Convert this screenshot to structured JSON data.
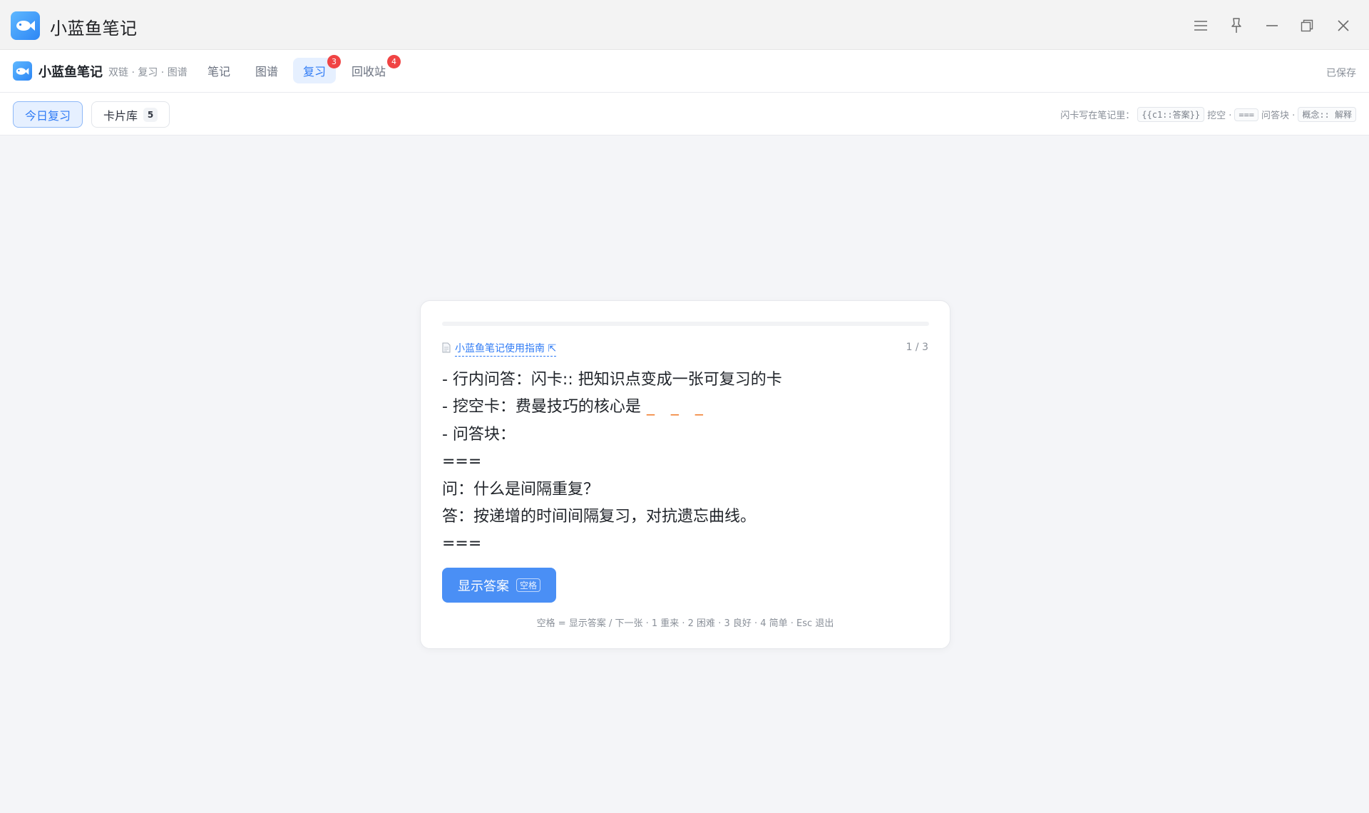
{
  "window": {
    "title": "小蓝鱼笔记"
  },
  "nav": {
    "brand_name": "小蓝鱼笔记",
    "brand_sub": "双链 · 复习 · 图谱",
    "tabs": [
      {
        "label": "笔记",
        "badge": ""
      },
      {
        "label": "图谱",
        "badge": ""
      },
      {
        "label": "复习",
        "badge": "3"
      },
      {
        "label": "回收站",
        "badge": "4"
      }
    ],
    "active_tab": "复习",
    "saved_status": "已保存"
  },
  "subbar": {
    "today_review": "今日复习",
    "card_library": "卡片库",
    "card_count": "5",
    "hint_prefix": "闪卡写在笔记里：",
    "hint_cloze_syntax": "{{c1::答案}}",
    "hint_cloze_label": "挖空 ·",
    "hint_block_syntax": "===",
    "hint_block_label": "问答块 ·",
    "hint_concept_syntax": "概念:: 解释"
  },
  "card": {
    "progress_fraction": 0.0,
    "source_title": "小蓝鱼笔记使用指南",
    "source_jump": "⇱",
    "counter": "1 / 3",
    "lines": [
      "- 行内问答：闪卡:: 把知识点变成一张可复习的卡",
      "- 挖空卡：费曼技巧的核心是",
      "- 问答块：",
      "===",
      "问：什么是间隔重复？",
      "答：按递增的时间间隔复习，对抗遗忘曲线。",
      "==="
    ],
    "cloze_mask": "_ _ _",
    "show_answer": "显示答案",
    "show_answer_key": "空格",
    "shortcuts": "空格 = 显示答案 / 下一张 · 1 重来 · 2 困难 · 3 良好 · 4 简单 · Esc 退出"
  },
  "colors": {
    "accent": "#2f7bf5",
    "button": "#4a8ff5",
    "badge": "#f04444",
    "cloze": "#f07b2a"
  }
}
